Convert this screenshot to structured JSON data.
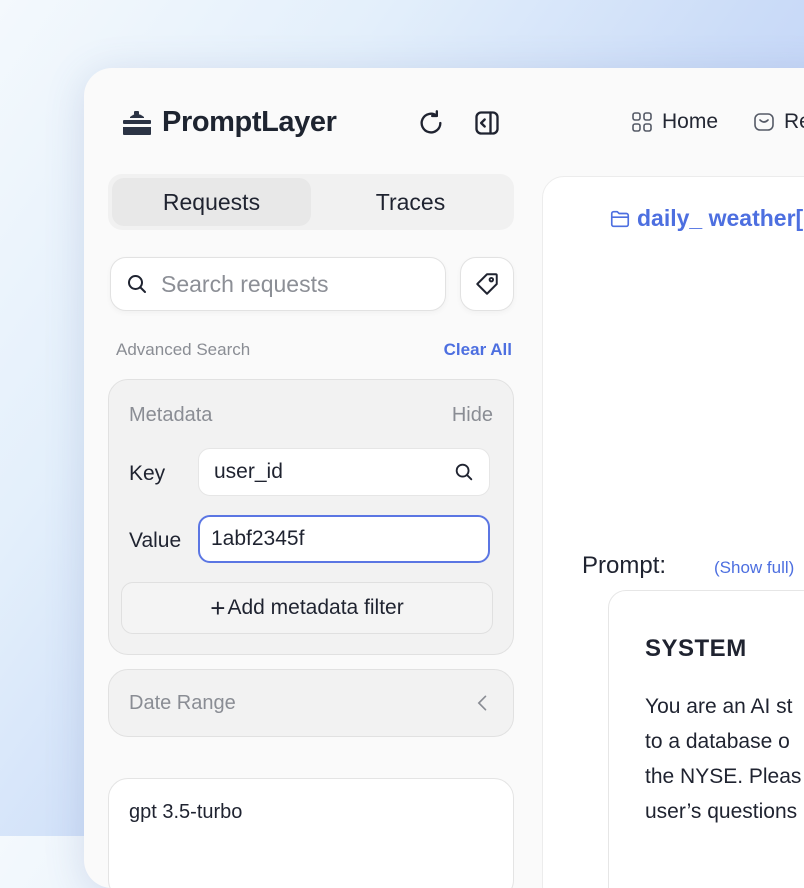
{
  "app": {
    "name": "PromptLayer"
  },
  "nav": {
    "home": "Home",
    "registry_partial": "Re"
  },
  "tabs": [
    {
      "label": "Requests",
      "active": true
    },
    {
      "label": "Traces",
      "active": false
    }
  ],
  "search": {
    "placeholder": "Search requests",
    "value": ""
  },
  "advanced": {
    "label": "Advanced Search",
    "clear_all": "Clear All"
  },
  "metadata": {
    "title": "Metadata",
    "hide": "Hide",
    "key_label": "Key",
    "key_value": "user_id",
    "value_label": "Value",
    "value_value": "1abf2345f",
    "add_filter": "Add metadata filter"
  },
  "date_range": {
    "label": "Date Range"
  },
  "requests": [
    {
      "model": "gpt 3.5-turbo"
    }
  ],
  "detail": {
    "folder_name": "daily_ weather[",
    "prompt_label": "Prompt:",
    "show_full": "(Show full)",
    "system_label": "SYSTEM",
    "system_lines": [
      "You are an AI st",
      "to a database o",
      "the NYSE. Pleas",
      "user’s questions"
    ]
  },
  "colors": {
    "accent": "#4d6fe0",
    "focus_border": "#5b76e3"
  },
  "icons": [
    "logo-icon",
    "refresh-icon",
    "sidebar-toggle-icon",
    "grid-icon",
    "registry-icon",
    "search-icon",
    "tag-icon",
    "chevron-left-icon",
    "folder-icon"
  ]
}
